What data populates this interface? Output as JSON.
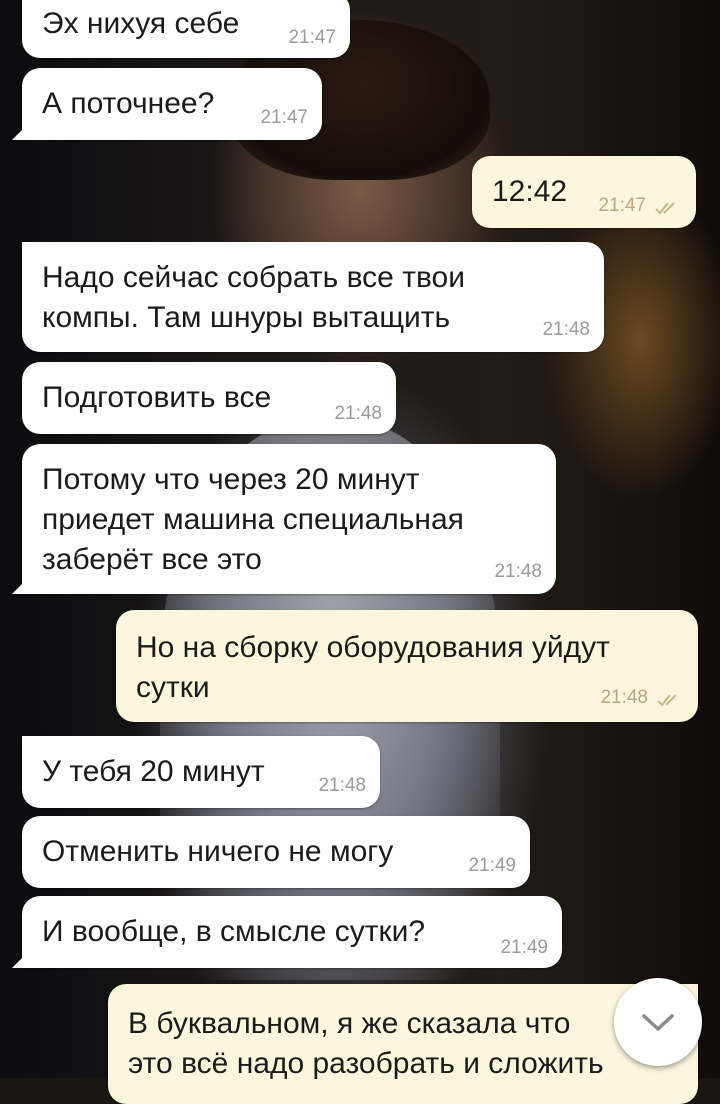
{
  "messages": [
    {
      "dir": "in",
      "text": "Эх нихуя себе",
      "time": "21:47"
    },
    {
      "dir": "in",
      "text": "А поточнее?",
      "time": "21:47"
    },
    {
      "dir": "out",
      "text": "12:42",
      "time": "21:47",
      "status": "read"
    },
    {
      "dir": "in",
      "text": "Надо сейчас собрать все твои\nкомпы. Там шнуры вытащить",
      "time": "21:48"
    },
    {
      "dir": "in",
      "text": "Подготовить все",
      "time": "21:48"
    },
    {
      "dir": "in",
      "text": "Потому что через 20 минут\nприедет машина специальная\nзаберёт все это",
      "time": "21:48"
    },
    {
      "dir": "out",
      "text": "Но на сборку оборудования уйдут\nсутки",
      "time": "21:48",
      "status": "read"
    },
    {
      "dir": "in",
      "text": "У тебя 20 минут",
      "time": "21:48"
    },
    {
      "dir": "in",
      "text": "Отменить ничего не могу",
      "time": "21:49"
    },
    {
      "dir": "in",
      "text": "И вообще, в смысле сутки?",
      "time": "21:49"
    },
    {
      "dir": "out",
      "text": "В буквальном, я же сказала что\nэто всё надо разобрать и сложить",
      "time": "",
      "status": ""
    }
  ],
  "icons": {
    "read_check": "double-check-icon",
    "scroll_down": "chevron-down-icon"
  },
  "colors": {
    "incoming_bubble": "#ffffff",
    "outgoing_bubble": "#fdf6df",
    "read_check": "#c9b98a"
  }
}
